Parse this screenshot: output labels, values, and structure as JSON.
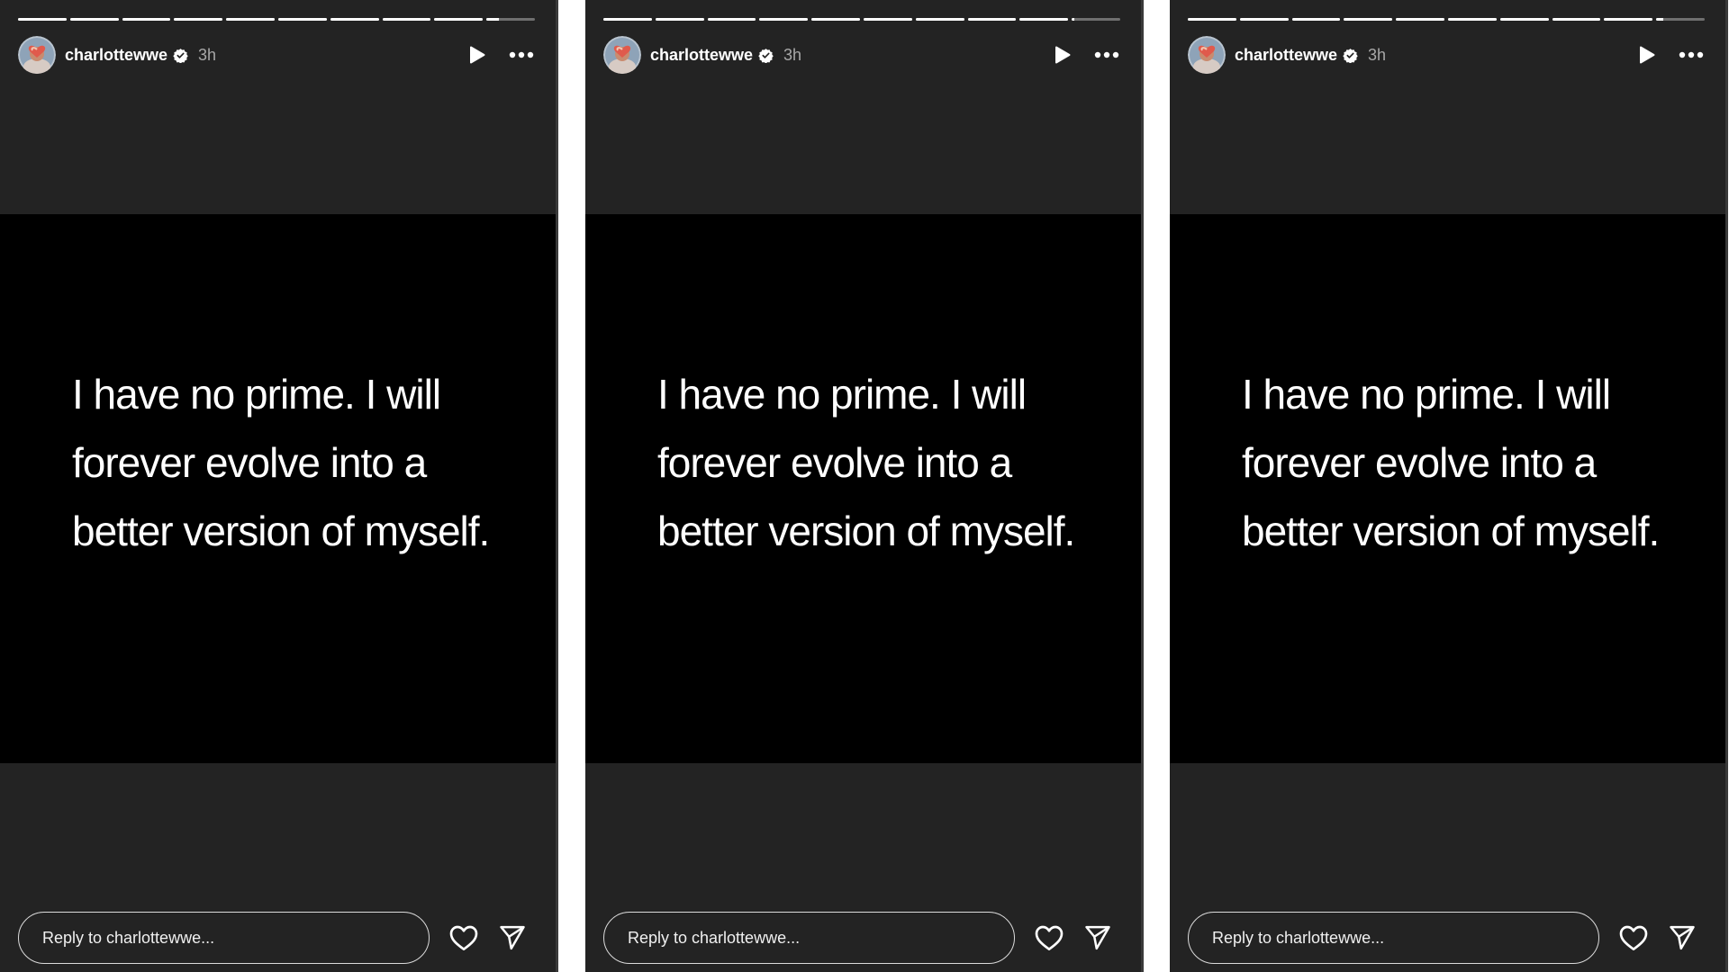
{
  "colors": {
    "panel_background": "#232323",
    "story_background": "#000000",
    "text_primary": "#ffffff",
    "text_secondary": "#a8a8a8",
    "verified_badge": "#ffffff",
    "separator": "#ffffff"
  },
  "stories": [
    {
      "segments_total": 10,
      "current_segment": 10,
      "current_segment_progress": 0.25,
      "user": {
        "username": "charlottewwe",
        "verified": true,
        "avatar_icon": "heart-hands-avatar"
      },
      "time_ago": "3h",
      "controls": {
        "play_icon": "play-icon",
        "more_icon": "more-options-icon"
      },
      "text": "I have no prime. I will forever evolve into a better version of myself.",
      "reply_placeholder": "Reply to charlottewwe...",
      "actions": {
        "like_icon": "heart-icon",
        "share_icon": "send-icon"
      }
    },
    {
      "segments_total": 10,
      "current_segment": 10,
      "current_segment_progress": 0.05,
      "user": {
        "username": "charlottewwe",
        "verified": true,
        "avatar_icon": "heart-hands-avatar"
      },
      "time_ago": "3h",
      "controls": {
        "play_icon": "play-icon",
        "more_icon": "more-options-icon"
      },
      "text": "I have no prime. I will forever evolve into a better version of myself.",
      "reply_placeholder": "Reply to charlottewwe...",
      "actions": {
        "like_icon": "heart-icon",
        "share_icon": "send-icon"
      }
    },
    {
      "segments_total": 10,
      "current_segment": 10,
      "current_segment_progress": 0.15,
      "user": {
        "username": "charlottewwe",
        "verified": true,
        "avatar_icon": "heart-hands-avatar"
      },
      "time_ago": "3h",
      "controls": {
        "play_icon": "play-icon",
        "more_icon": "more-options-icon"
      },
      "text": "I have no prime. I will forever evolve into a better version of myself.",
      "reply_placeholder": "Reply to charlottewwe...",
      "actions": {
        "like_icon": "heart-icon",
        "share_icon": "send-icon"
      }
    }
  ]
}
